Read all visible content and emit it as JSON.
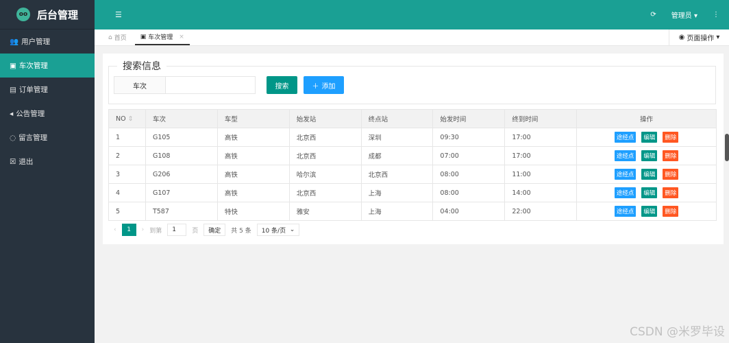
{
  "app": {
    "title": "后台管理"
  },
  "sidebar": {
    "items": [
      {
        "label": "用户管理",
        "icon": "users-icon",
        "glyph": "👥"
      },
      {
        "label": "车次管理",
        "icon": "train-icon",
        "glyph": "▣"
      },
      {
        "label": "订单管理",
        "icon": "card-icon",
        "glyph": "▤"
      },
      {
        "label": "公告管理",
        "icon": "speaker-icon",
        "glyph": "◂"
      },
      {
        "label": "留言管理",
        "icon": "chat-icon",
        "glyph": "◌"
      },
      {
        "label": "退出",
        "icon": "close-box-icon",
        "glyph": "☒"
      }
    ]
  },
  "header": {
    "user": "管理员"
  },
  "tabs": [
    {
      "label": "首页"
    },
    {
      "label": "车次管理"
    }
  ],
  "page_op": "页面操作",
  "search": {
    "legend": "搜索信息",
    "field_label": "车次",
    "value": "",
    "search_btn": "搜索",
    "add_btn": "添加"
  },
  "table": {
    "headers": [
      "NO",
      "车次",
      "车型",
      "始发站",
      "终点站",
      "始发时间",
      "终到时间",
      "操作"
    ],
    "rows": [
      [
        "1",
        "G105",
        "高铁",
        "北京西",
        "深圳",
        "09:30",
        "17:00"
      ],
      [
        "2",
        "G108",
        "高铁",
        "北京西",
        "成都",
        "07:00",
        "17:00"
      ],
      [
        "3",
        "G206",
        "高铁",
        "哈尔滨",
        "北京西",
        "08:00",
        "11:00"
      ],
      [
        "4",
        "G107",
        "高铁",
        "北京西",
        "上海",
        "08:00",
        "14:00"
      ],
      [
        "5",
        "T587",
        "特快",
        "雅安",
        "上海",
        "04:00",
        "22:00"
      ]
    ],
    "actions": [
      "途经点",
      "编辑",
      "删除"
    ]
  },
  "pager": {
    "current": "1",
    "goto": "到第",
    "page_input": "1",
    "page_unit": "页",
    "confirm": "确定",
    "total": "共 5 条",
    "size": "10 条/页"
  },
  "watermark": "CSDN @米罗毕设"
}
